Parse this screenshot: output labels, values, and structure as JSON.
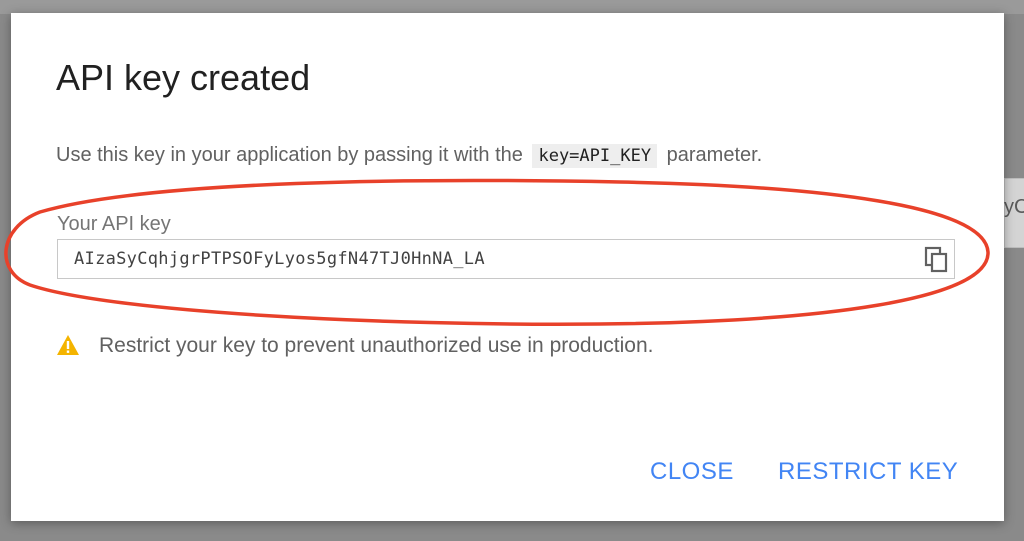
{
  "background": {
    "partial_text": "yC"
  },
  "dialog": {
    "title": "API key created",
    "description_before": "Use this key in your application by passing it with the",
    "description_code": "key=API_KEY",
    "description_after": "parameter.",
    "field_label": "Your API key",
    "api_key": "AIzaSyCqhjgrPTPSOFyLyos5gfN47TJ0HnNA_LA",
    "copy_icon": "copy-icon",
    "warning_icon": "warning-triangle-icon",
    "warning_text": "Restrict your key to prevent unauthorized use in production.",
    "close_label": "CLOSE",
    "restrict_label": "RESTRICT KEY"
  },
  "colors": {
    "accent": "#4285f4",
    "warning": "#f4b400",
    "annotation": "#e8412a"
  }
}
